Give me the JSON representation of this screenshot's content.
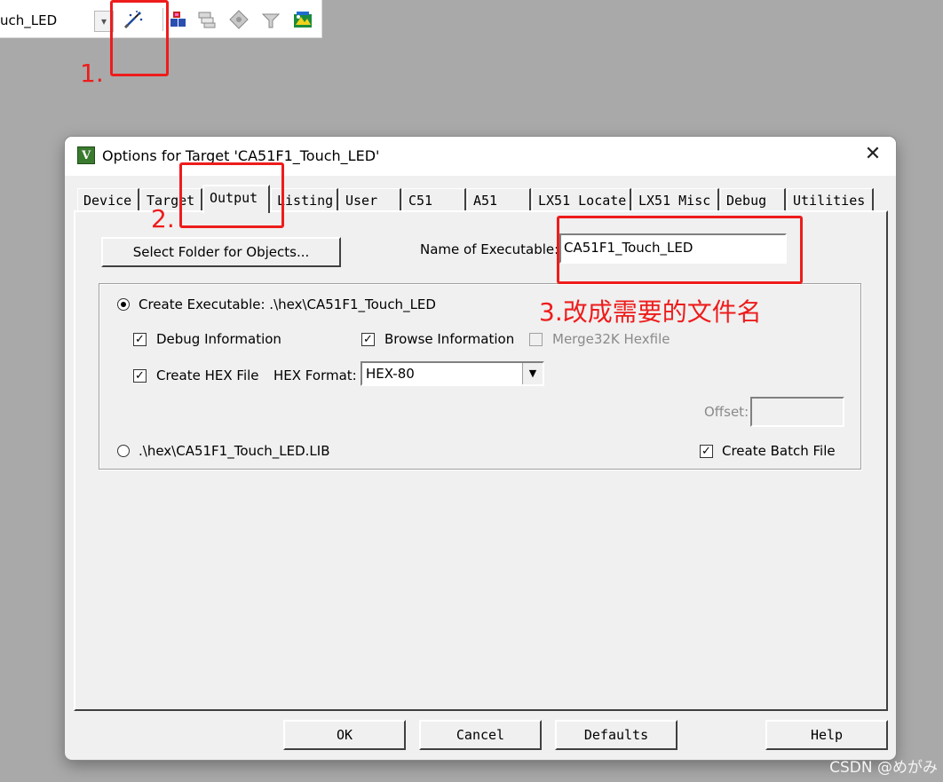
{
  "toolbar": {
    "target_name": "uch_LED",
    "icons": [
      "options-for-target-icon",
      "translate-icon",
      "build-icon",
      "rebuild-icon",
      "download-icon",
      "batch-build-icon"
    ]
  },
  "annotations": {
    "step1": "1.",
    "step2": "2.",
    "step3": "3.改成需要的文件名",
    "color": "#ee1c1c"
  },
  "dialog": {
    "title": "Options for Target 'CA51F1_Touch_LED'",
    "icon_letter": "V",
    "close_symbol": "✕",
    "tabs": [
      "Device",
      "Target",
      "Output",
      "Listing",
      "User",
      "C51",
      "A51",
      "LX51 Locate",
      "LX51 Misc",
      "Debug",
      "Utilities"
    ],
    "active_tab": "Output",
    "select_folder_label": "Select Folder for Objects...",
    "name_of_executable_label": "Name of Executable:",
    "name_of_executable_value": "CA51F1_Touch_LED",
    "create_executable_label": "Create Executable:  .\\hex\\CA51F1_Touch_LED",
    "create_executable_selected": true,
    "debug_info_label": "Debug Information",
    "debug_info_checked": true,
    "browse_info_label": "Browse Information",
    "browse_info_checked": true,
    "merge_hex_label": "Merge32K Hexfile",
    "merge_hex_checked": false,
    "create_hex_label": "Create HEX File",
    "create_hex_checked": true,
    "hex_format_label": "HEX Format:",
    "hex_format_value": "HEX-80",
    "offset_label": "Offset:",
    "offset_value": "",
    "create_library_label": ".\\hex\\CA51F1_Touch_LED.LIB",
    "create_library_selected": false,
    "create_batch_label": "Create Batch File",
    "create_batch_checked": true,
    "buttons": {
      "ok": "OK",
      "cancel": "Cancel",
      "defaults": "Defaults",
      "help": "Help"
    }
  },
  "watermark": "CSDN @めがみ"
}
